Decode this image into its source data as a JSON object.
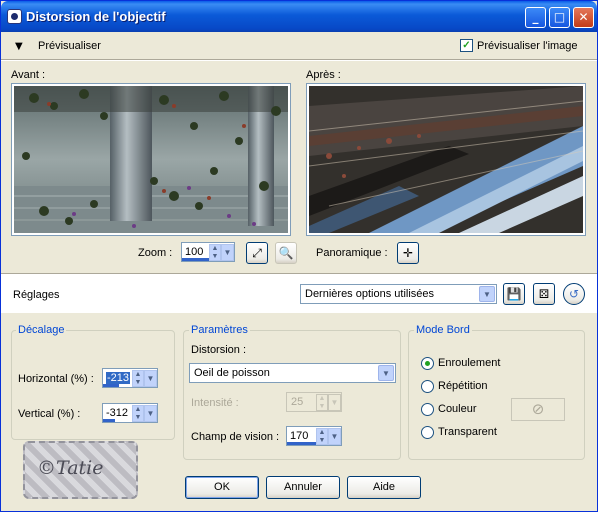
{
  "window": {
    "title": "Distorsion de l'objectif",
    "controls": {
      "minimize": "_",
      "maximize": "□",
      "close": "✕"
    }
  },
  "preview_bar": {
    "toggle_label": "Prévisualiser",
    "preview_image_label": "Prévisualiser l'image",
    "preview_image_checked": true
  },
  "previews": {
    "before_label": "Avant :",
    "after_label": "Après :"
  },
  "zoom": {
    "label": "Zoom :",
    "value": "100",
    "pan_label": "Panoramique :"
  },
  "settings": {
    "label": "Réglages",
    "preset_value": "Dernières options utilisées"
  },
  "offset_group": {
    "title": "Décalage",
    "horizontal_label": "Horizontal (%) :",
    "horizontal_value": "-213",
    "vertical_label": "Vertical (%) :",
    "vertical_value": "-312"
  },
  "params_group": {
    "title": "Paramètres",
    "distortion_label": "Distorsion :",
    "distortion_value": "Oeil de poisson",
    "intensity_label": "Intensité :",
    "intensity_value": "25",
    "fov_label": "Champ de vision :",
    "fov_value": "170"
  },
  "edge_group": {
    "title": "Mode Bord",
    "options": [
      "Enroulement",
      "Répétition",
      "Couleur",
      "Transparent"
    ],
    "selected": "Enroulement"
  },
  "buttons": {
    "ok": "OK",
    "cancel": "Annuler",
    "help": "Aide"
  },
  "watermark": "©Tatie"
}
